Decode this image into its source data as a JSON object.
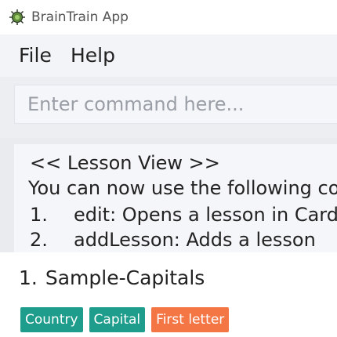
{
  "window": {
    "title": "BrainTrain App",
    "icon": "brain-bug-icon"
  },
  "menu": {
    "file_label": "File",
    "help_label": "Help"
  },
  "command": {
    "placeholder": "Enter command here...",
    "value": ""
  },
  "result": {
    "lines": [
      {
        "number": "",
        "text": "<< Lesson View >>"
      },
      {
        "number": "",
        "text": "You can now use the following cor"
      },
      {
        "number": "1.",
        "text": "edit: Opens a lesson in Card V"
      },
      {
        "number": "2.",
        "text": "addLesson: Adds a lesson"
      }
    ]
  },
  "lesson": {
    "index": "1.",
    "name": "Sample-Capitals",
    "tags": [
      {
        "label": "Country",
        "color": "#1e9c8c"
      },
      {
        "label": "Capital",
        "color": "#1e9c8c"
      },
      {
        "label": "First letter",
        "color": "#f47645"
      }
    ]
  },
  "colors": {
    "teal_tag": "#1e9c8c",
    "orange_tag": "#f47645",
    "menubar_bg": "#f3f4f7"
  }
}
